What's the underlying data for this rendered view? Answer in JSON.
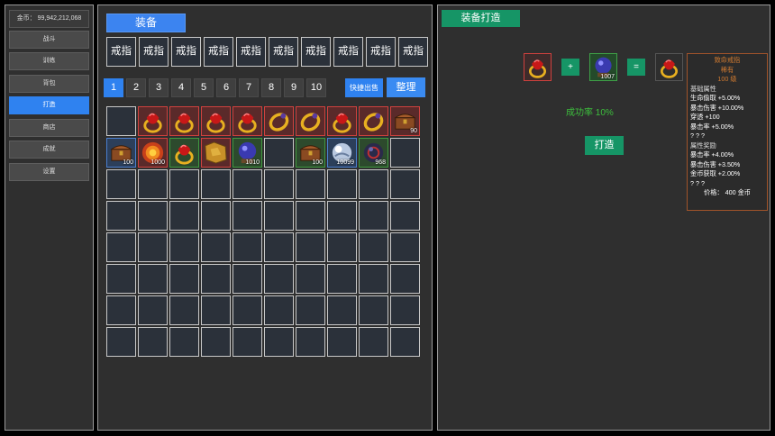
{
  "sidebar": {
    "gold": "金币： 99,942,212,068",
    "items": [
      {
        "label": "战斗",
        "active": false
      },
      {
        "label": "训练",
        "active": false
      },
      {
        "label": "背包",
        "active": false
      },
      {
        "label": "打造",
        "active": true
      },
      {
        "label": "商店",
        "active": false
      },
      {
        "label": "成就",
        "active": false
      },
      {
        "label": "设置",
        "active": false
      }
    ]
  },
  "inventory": {
    "tab_title": "装备",
    "types": [
      "戒指",
      "戒指",
      "戒指",
      "戒指",
      "戒指",
      "戒指",
      "戒指",
      "戒指",
      "戒指",
      "戒指"
    ],
    "pages": [
      "1",
      "2",
      "3",
      "4",
      "5",
      "6",
      "7",
      "8",
      "9",
      "10"
    ],
    "active_page": "1",
    "quick_sell": "快捷出售",
    "sort": "整理",
    "items": [
      {
        "cell": 1,
        "icon": "ruby-ring-icon",
        "quality": "red",
        "count": ""
      },
      {
        "cell": 2,
        "icon": "ruby-ring-icon",
        "quality": "red",
        "count": ""
      },
      {
        "cell": 3,
        "icon": "ruby-ring-icon",
        "quality": "red",
        "count": ""
      },
      {
        "cell": 4,
        "icon": "ruby-ring-icon",
        "quality": "red",
        "count": ""
      },
      {
        "cell": 5,
        "icon": "gold-ring-icon",
        "quality": "red",
        "count": ""
      },
      {
        "cell": 6,
        "icon": "gold-ring-icon",
        "quality": "red",
        "count": ""
      },
      {
        "cell": 7,
        "icon": "ruby-ring-icon",
        "quality": "red",
        "count": ""
      },
      {
        "cell": 8,
        "icon": "gold-ring-icon",
        "quality": "red",
        "count": ""
      },
      {
        "cell": 9,
        "icon": "treasure-chest-icon",
        "quality": "red",
        "count": "90"
      },
      {
        "cell": 10,
        "icon": "treasure-chest-icon",
        "quality": "blue",
        "count": "100"
      },
      {
        "cell": 11,
        "icon": "fire-orb-icon",
        "quality": "red",
        "count": "1000"
      },
      {
        "cell": 12,
        "icon": "ruby-ring-icon",
        "quality": "green",
        "count": ""
      },
      {
        "cell": 13,
        "icon": "gold-ore-icon",
        "quality": "red",
        "count": ""
      },
      {
        "cell": 14,
        "icon": "crystal-ball-icon",
        "quality": "green",
        "count": "1010"
      },
      {
        "cell": 16,
        "icon": "treasure-chest-icon",
        "quality": "green",
        "count": "100"
      },
      {
        "cell": 17,
        "icon": "silver-orb-icon",
        "quality": "blue",
        "count": "10099"
      },
      {
        "cell": 18,
        "icon": "dark-orb-icon",
        "quality": "green",
        "count": "968"
      }
    ]
  },
  "forge": {
    "title": "装备打造",
    "plus": "+",
    "equals": "=",
    "material_count": "1007",
    "success_rate": "成功率 10%",
    "forge_button": "打造",
    "tooltip": {
      "name": "致命戒指",
      "quality": "稀有",
      "level": "100 级",
      "base_header": "基础属性",
      "base_stats": [
        "生命偷取 +5.00%",
        "暴击伤害 +10.00%",
        "穿透 +100",
        "暴击率 +5.00%",
        "? ? ?"
      ],
      "bonus_header": "属性奖励",
      "bonus_stats": [
        "暴击率 +4.00%",
        "暴击伤害 +3.50%",
        "金币获取 +2.00%",
        "? ? ?"
      ],
      "price": "价格： 400 金币"
    }
  },
  "colors": {
    "blue_accent": "#2f82f0",
    "green_accent": "#169566",
    "quality_red": "#d0413e",
    "quality_green": "#3f9a3f",
    "quality_blue": "#4a7fcf",
    "tooltip_title": "#d07a30",
    "success_text": "#3dbf3d"
  }
}
